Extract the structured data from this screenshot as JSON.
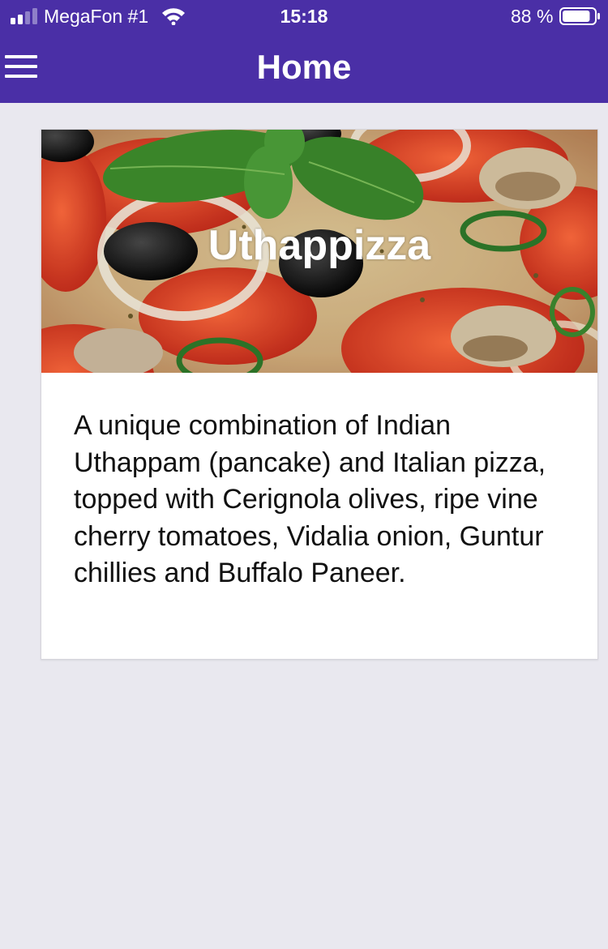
{
  "status_bar": {
    "carrier": "MegaFon #1",
    "time": "15:18",
    "battery": "88 %",
    "battery_level": 0.88,
    "icons": [
      "signal-icon",
      "wifi-icon",
      "battery-icon"
    ]
  },
  "header": {
    "title": "Home",
    "menu_icon": "menu-icon",
    "background_color": "#4a2fa6"
  },
  "card": {
    "title": "Uthappizza",
    "image": "pizza-image",
    "description": "A unique combination of Indian Uthappam (pancake) and Italian pizza, topped with Cerignola olives, ripe vine cherry tomatoes, Vidalia onion, Guntur chillies and Buffalo Paneer."
  }
}
